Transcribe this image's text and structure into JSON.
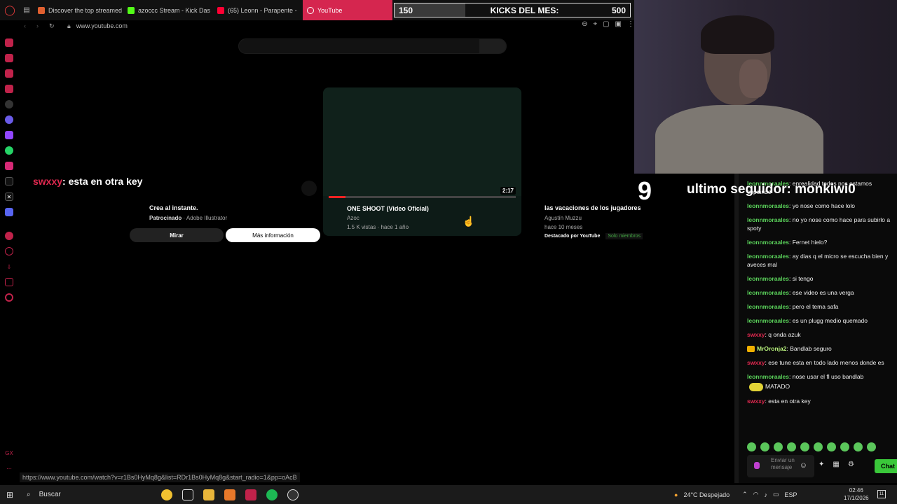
{
  "browser": {
    "tabs": [
      {
        "label": "Discover the top streamed",
        "color": "#e06030",
        "active": false
      },
      {
        "label": "azoccc Stream - Kick Das",
        "color": "#53fc18",
        "active": false
      },
      {
        "label": "(65) Leonn - Parapente -",
        "color": "#ff0033",
        "active": false
      },
      {
        "label": "YouTube",
        "color": "#ff0033",
        "active": true
      }
    ],
    "url": "www.youtube.com",
    "status_url": "https://www.youtube.com/watch?v=r1Bs0HyMq8g&list=RDr1Bs0HyMq8g&start_radio=1&pp=oAcB"
  },
  "youtube": {
    "ad": {
      "title": "Crea al instante.",
      "sponsored": "Patrocinado",
      "advertiser": "Adobe Illustrator",
      "watch_label": "Mirar",
      "info_label": "Más información"
    },
    "video": {
      "title": "ONE SHOOT (Video Oficial)",
      "channel": "Azoc",
      "meta": "1.5 K vistas · hace 1 año",
      "duration": "2:17",
      "progress_fraction": 0.09
    },
    "right_video": {
      "title": "las vacaciones de los jugadores",
      "channel": "Agustín Muzzu",
      "meta": "hace 10 meses",
      "featured": "Destacado por YouTube",
      "members_badge": "Solo miembros"
    }
  },
  "overlay": {
    "chat_user": "swxxy",
    "chat_text": ": esta en otra key",
    "kicks_current": "150",
    "kicks_label": "KICKS DEL MES:",
    "kicks_goal": "500",
    "kicks_fraction": 0.3,
    "counter": "9",
    "last_follower": "ultimo seguidor: monkiwi0"
  },
  "chat": {
    "messages": [
      {
        "user": "leonnmoraales",
        "text": ": enrealidad todos nos estamos copiando",
        "color": "green"
      },
      {
        "user": "leonnmoraales",
        "text": ": yo nose como hace lolo",
        "color": "green"
      },
      {
        "user": "leonnmoraales",
        "text": ": no yo nose como hace para subirlo a spoty",
        "color": "green"
      },
      {
        "user": "leonnmoraales",
        "text": ": Fernet hielo?",
        "color": "green"
      },
      {
        "user": "leonnmoraales",
        "text": ": ay dias q el micro se escucha bien y aveces mal",
        "color": "green"
      },
      {
        "user": "leonnmoraales",
        "text": ": si tengo",
        "color": "green"
      },
      {
        "user": "leonnmoraales",
        "text": ": ese video es una verga",
        "color": "green"
      },
      {
        "user": "leonnmoraales",
        "text": ": pero el tema safa",
        "color": "green"
      },
      {
        "user": "leonnmoraales",
        "text": ": es un plugg medio quemado",
        "color": "green"
      },
      {
        "user": "swxxy",
        "text": ": q onda azuk",
        "color": "red"
      },
      {
        "user": "MrOronja2",
        "text": ": Bandlab seguro",
        "color": "lime"
      },
      {
        "user": "swxxy",
        "text": ": ese tune esta en todo lado menos donde es",
        "color": "red"
      },
      {
        "user": "leonnmoraales",
        "text": ": nose usar el fl uso bandlab",
        "color": "green"
      },
      {
        "user": "",
        "text": "MATADO",
        "color": "green"
      },
      {
        "user": "swxxy",
        "text": ": esta en otra key",
        "color": "red"
      }
    ],
    "input_placeholder": "Enviar un mensaje",
    "send_label": "Chat"
  },
  "taskbar": {
    "search_label": "Buscar",
    "weather": "24°C  Despejado",
    "language": "ESP",
    "time": "02:46",
    "date": "17/1/2026",
    "notifications": "11"
  }
}
